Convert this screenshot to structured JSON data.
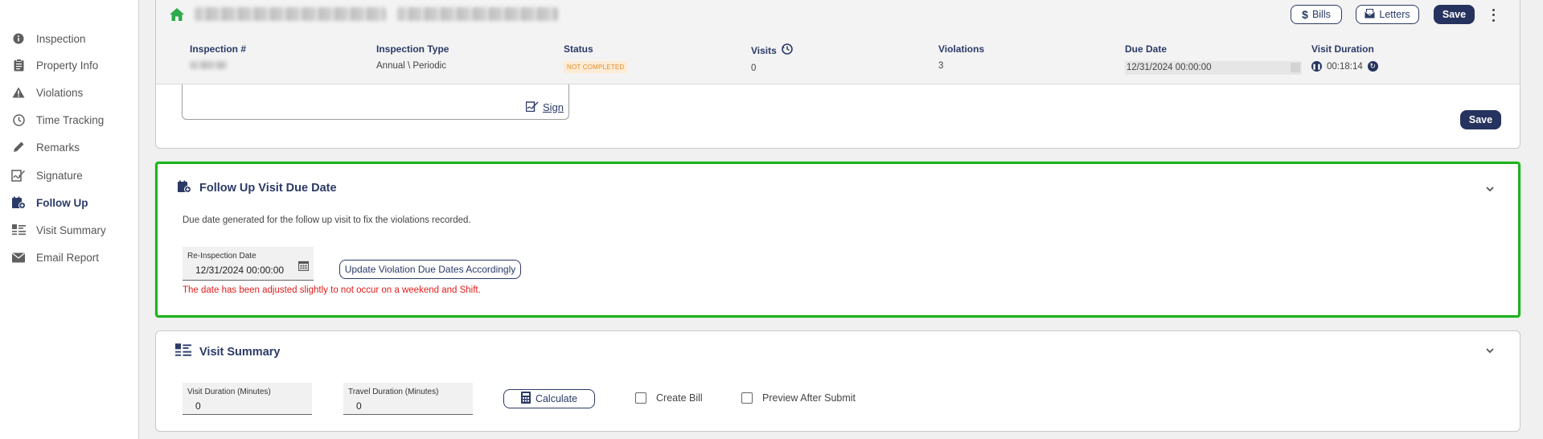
{
  "sidebar": {
    "items": [
      {
        "label": "Inspection",
        "icon": "info-icon"
      },
      {
        "label": "Property Info",
        "icon": "clipboard-icon"
      },
      {
        "label": "Violations",
        "icon": "warning-icon"
      },
      {
        "label": "Time Tracking",
        "icon": "clock-icon"
      },
      {
        "label": "Remarks",
        "icon": "pencil-icon"
      },
      {
        "label": "Signature",
        "icon": "signature-icon"
      },
      {
        "label": "Follow Up",
        "icon": "calendar-plus-icon",
        "active": true
      },
      {
        "label": "Visit Summary",
        "icon": "list-icon"
      },
      {
        "label": "Email Report",
        "icon": "envelope-icon"
      }
    ]
  },
  "header": {
    "buttons": {
      "bills": "Bills",
      "letters": "Letters",
      "save": "Save"
    },
    "meta": {
      "inspection_label": "Inspection #",
      "type_label": "Inspection Type",
      "type_value": "Annual \\ Periodic",
      "status_label": "Status",
      "status_value": "NOT COMPLETED",
      "visits_label": "Visits",
      "visits_value": "0",
      "violations_label": "Violations",
      "violations_value": "3",
      "due_label": "Due Date",
      "due_value": "12/31/2024 00:00:00",
      "duration_label": "Visit Duration",
      "duration_value": "00:18:14"
    }
  },
  "signature": {
    "sign_label": "Sign",
    "save_label": "Save"
  },
  "follow_up": {
    "title": "Follow Up Visit Due Date",
    "description": "Due date generated for the follow up visit to fix the violations recorded.",
    "reinspection_label": "Re-Inspection Date",
    "reinspection_value": "12/31/2024 00:00:00",
    "update_button": "Update Violation Due Dates Accordingly",
    "warning": "The date has been adjusted slightly to not occur on a weekend and Shift."
  },
  "visit_summary": {
    "title": "Visit Summary",
    "visit_duration_label": "Visit Duration (Minutes)",
    "visit_duration_value": "0",
    "travel_duration_label": "Travel Duration (Minutes)",
    "travel_duration_value": "0",
    "calculate_button": "Calculate",
    "create_bill_label": "Create Bill",
    "preview_label": "Preview After Submit"
  },
  "colors": {
    "accent": "#2b3a67",
    "home_green": "#2dab4d",
    "highlight_green": "#1db21d",
    "warning_red": "#e31b1b",
    "status_orange": "#e0902e"
  }
}
